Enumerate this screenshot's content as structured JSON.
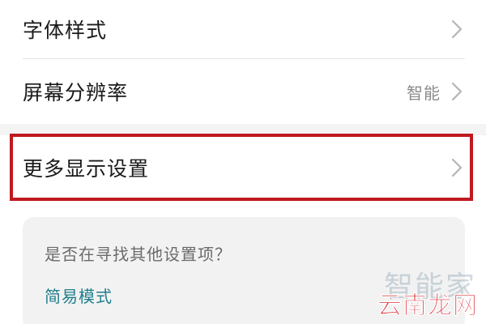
{
  "settings": {
    "items": [
      {
        "label": "字体样式",
        "value": ""
      },
      {
        "label": "屏幕分辨率",
        "value": "智能"
      },
      {
        "label": "更多显示设置",
        "value": ""
      }
    ]
  },
  "suggestion_card": {
    "question": "是否在寻找其他设置项？",
    "link_label": "简易模式"
  },
  "watermark": {
    "top_text": "智能家",
    "bottom_text": "云南龙网"
  },
  "colors": {
    "highlight_border": "#c0191f",
    "link": "#1f7e8c",
    "value_text": "#8a8a8a"
  },
  "icons": {
    "row_arrow": "chevron-right-icon"
  }
}
